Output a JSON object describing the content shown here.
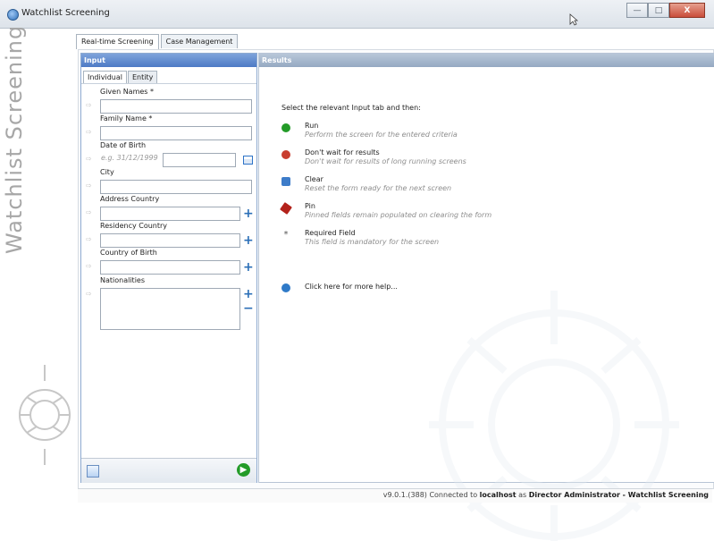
{
  "window": {
    "title": "Watchlist Screening",
    "minimize": "—",
    "maximize": "□",
    "close": "X"
  },
  "brand": {
    "text": "Watchlist Screening"
  },
  "tabs": [
    {
      "label": "Real-time Screening"
    },
    {
      "label": "Case Management"
    }
  ],
  "input_panel": {
    "header": "Input",
    "subtabs": [
      {
        "label": "Individual"
      },
      {
        "label": "Entity"
      }
    ],
    "fields": {
      "given_names": {
        "label": "Given Names *",
        "value": ""
      },
      "family_name": {
        "label": "Family Name *",
        "value": ""
      },
      "dob": {
        "label": "Date of Birth",
        "placeholder": "e.g. 31/12/1999",
        "value": ""
      },
      "city": {
        "label": "City",
        "value": ""
      },
      "address_country": {
        "label": "Address Country",
        "value": ""
      },
      "residency_country": {
        "label": "Residency Country",
        "value": ""
      },
      "country_of_birth": {
        "label": "Country of Birth",
        "value": ""
      },
      "nationalities": {
        "label": "Nationalities",
        "value": ""
      }
    },
    "run_label": "▶"
  },
  "results_panel": {
    "header": "Results",
    "intro": "Select the relevant Input tab and then:",
    "items": [
      {
        "title": "Run",
        "desc": "Perform the screen for the entered criteria",
        "icon": "run-icon",
        "color": "#239b28"
      },
      {
        "title": "Don't wait for results",
        "desc": "Don't wait for results of long running screens",
        "icon": "dont-wait-icon",
        "color": "#c83d2f"
      },
      {
        "title": "Clear",
        "desc": "Reset the form ready for the next screen",
        "icon": "clear-icon",
        "color": "#3d7cc9"
      },
      {
        "title": "Pin",
        "desc": "Pinned fields remain populated on clearing the form",
        "icon": "pin-icon",
        "color": "#b3221b"
      },
      {
        "title": "Required Field",
        "desc": "This field is mandatory for the screen",
        "icon": "asterisk-icon",
        "color": "#555555"
      }
    ],
    "help_text": "Click here for more help..."
  },
  "status": {
    "version": "v9.0.1.(388) Connected to ",
    "host": "localhost",
    "as": " as ",
    "user": "Director Administrator - Watchlist Screening"
  },
  "colors": {
    "input_header": "#5f86ca",
    "results_header": "#a8b8cb",
    "accent_blue": "#2b6fb7"
  }
}
